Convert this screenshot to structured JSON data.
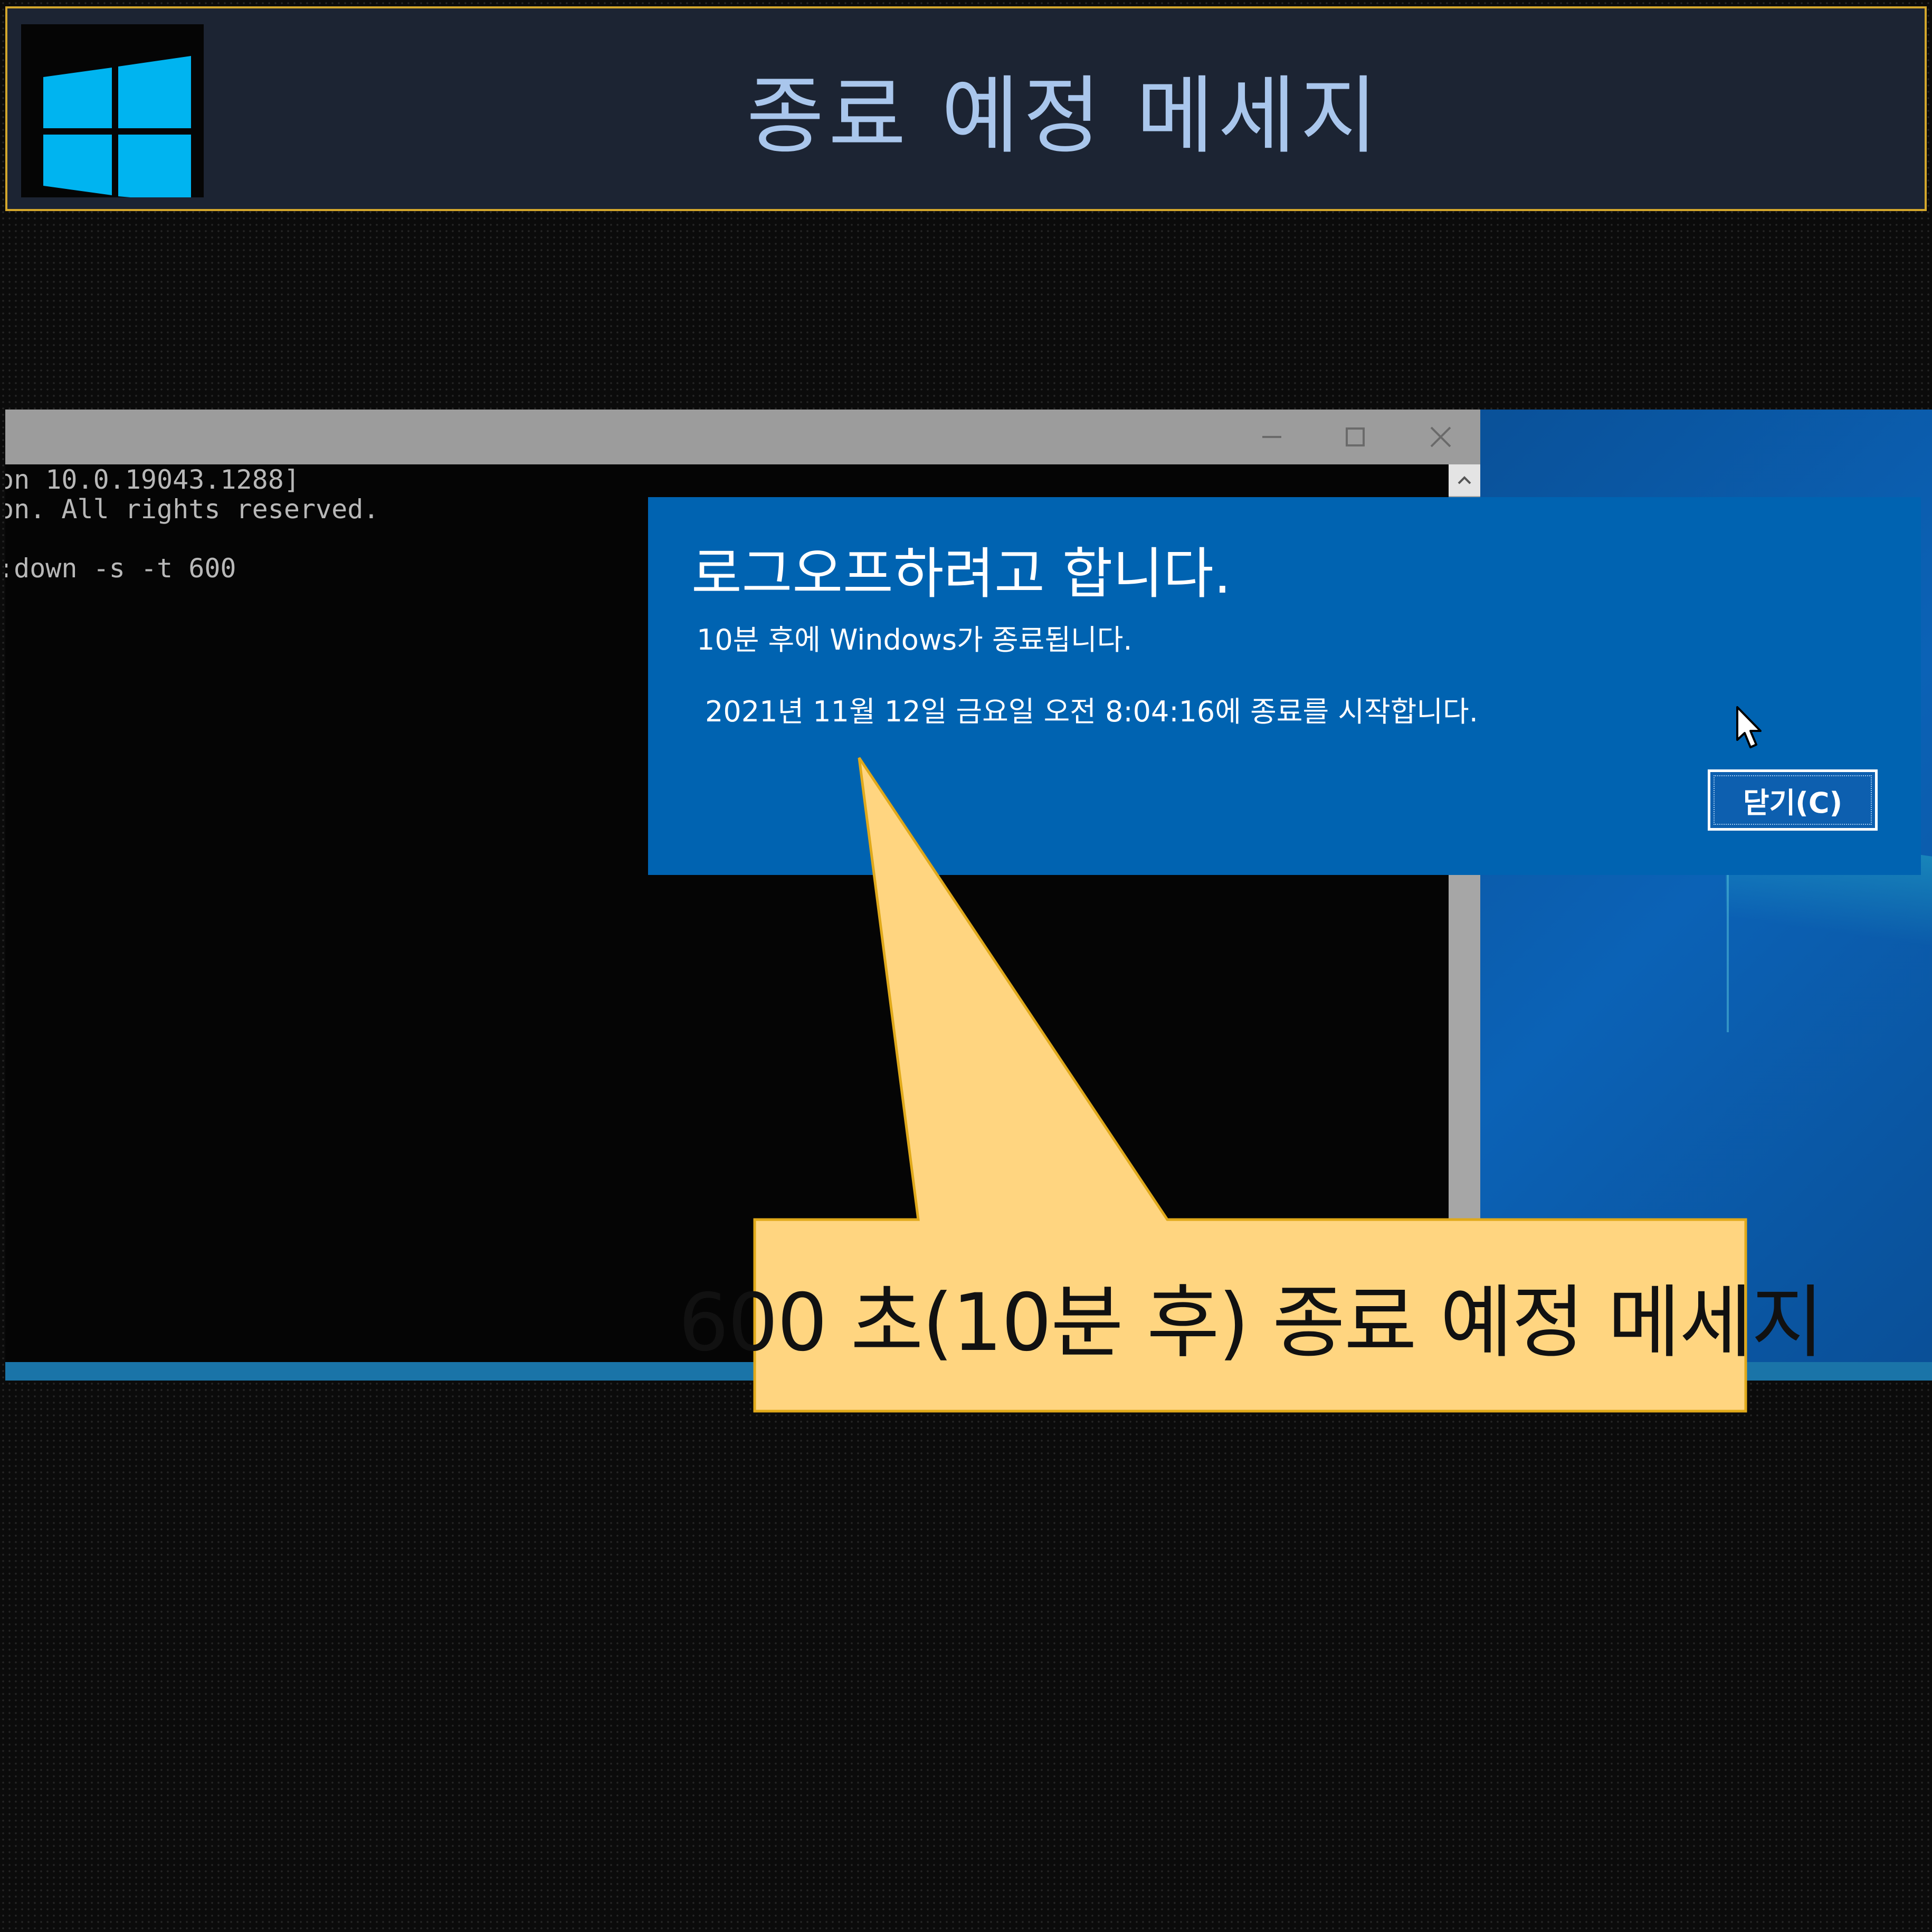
{
  "header": {
    "title": "종료 예정 메세지",
    "logo_icon": "windows-logo-icon"
  },
  "cmd": {
    "lines": [
      "on 10.0.19043.1288]",
      "on. All rights reserved.",
      ":down -s -t 600"
    ],
    "buttons": {
      "minimize": "minimize-icon",
      "maximize": "maximize-icon",
      "close": "close-icon"
    }
  },
  "dialog": {
    "title": "로그오프하려고 합니다.",
    "subtitle": "10분 후에 Windows가 종료됩니다.",
    "schedule": "2021년 11월 12일 금요일 오전 8:04:16에 종료를 시작합니다.",
    "close_label": "닫기(C)"
  },
  "callout": {
    "text": "600 초(10분 후) 종료 예정 메세지"
  },
  "colors": {
    "header_bg": "#1c2433",
    "header_border": "#d4a72c",
    "header_text": "#a9c6ec",
    "windows_blue": "#00b4f0",
    "dialog_bg": "#0063b1",
    "callout_bg": "#ffd580",
    "callout_border": "#e0a91a"
  }
}
